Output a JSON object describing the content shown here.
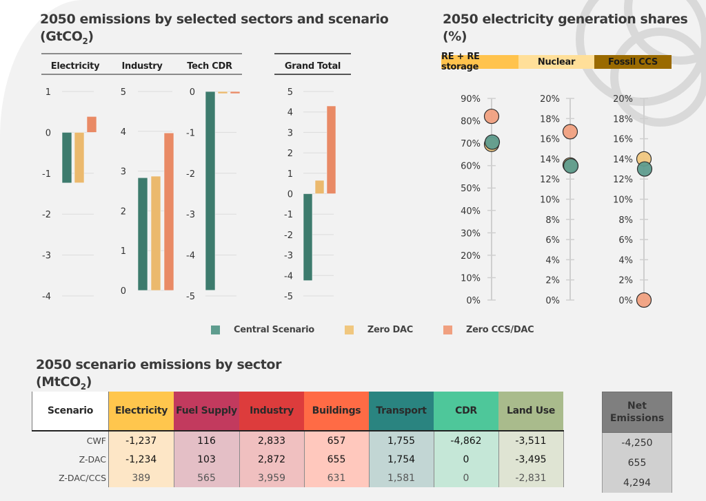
{
  "left_chart": {
    "title_line1": "2050 emissions by selected sectors and scenario",
    "title_line2_prefix": "(GtCO",
    "title_line2_sub": "2",
    "title_line2_suffix": ")",
    "panel_labels": [
      "Electricity",
      "Industry",
      "Tech CDR",
      "Grand Total"
    ]
  },
  "right_chart": {
    "title_line1": "2050 electricity generation shares",
    "title_line2": "(%)",
    "categories": [
      {
        "label": "RE + RE storage",
        "color": "#ffc34d"
      },
      {
        "label": "Nuclear",
        "color": "#ffdf99"
      },
      {
        "label": "Fossil CCS",
        "color": "#9a6a00"
      }
    ]
  },
  "legend": [
    {
      "label": "Central Scenario",
      "color": "#5e9c8e"
    },
    {
      "label": "Zero DAC",
      "color": "#f0c77f"
    },
    {
      "label": "Zero CCS/DAC",
      "color": "#f0a080"
    }
  ],
  "chart_data": [
    {
      "type": "bar",
      "title": "2050 emissions by selected sectors and scenario (GtCO2) - Electricity",
      "ylabel": "GtCO2",
      "categories": [
        "Electricity"
      ],
      "series": [
        {
          "name": "Central Scenario",
          "values": [
            -1.237
          ]
        },
        {
          "name": "Zero DAC",
          "values": [
            -1.234
          ]
        },
        {
          "name": "Zero CCS/DAC",
          "values": [
            0.389
          ]
        }
      ],
      "ylim": [
        -4,
        1
      ],
      "yticks": [
        1,
        0,
        -1,
        -2,
        -3,
        -4
      ],
      "grid": true
    },
    {
      "type": "bar",
      "title": "Industry",
      "ylabel": "GtCO2",
      "categories": [
        "Industry"
      ],
      "series": [
        {
          "name": "Central Scenario",
          "values": [
            2.833
          ]
        },
        {
          "name": "Zero DAC",
          "values": [
            2.872
          ]
        },
        {
          "name": "Zero CCS/DAC",
          "values": [
            3.959
          ]
        }
      ],
      "ylim": [
        0,
        5
      ],
      "yticks": [
        5,
        4,
        3,
        2,
        1,
        0
      ],
      "grid": true
    },
    {
      "type": "bar",
      "title": "Tech CDR",
      "ylabel": "GtCO2",
      "categories": [
        "Tech CDR"
      ],
      "series": [
        {
          "name": "Central Scenario",
          "values": [
            -4.862
          ]
        },
        {
          "name": "Zero DAC",
          "values": [
            -0.05
          ]
        },
        {
          "name": "Zero CCS/DAC",
          "values": [
            -0.05
          ]
        }
      ],
      "ylim": [
        -5,
        0
      ],
      "yticks": [
        0,
        -1,
        -2,
        -3,
        -4,
        -5
      ],
      "grid": true
    },
    {
      "type": "bar",
      "title": "Grand Total",
      "ylabel": "GtCO2",
      "categories": [
        "Grand Total"
      ],
      "series": [
        {
          "name": "Central Scenario",
          "values": [
            -4.25
          ]
        },
        {
          "name": "Zero DAC",
          "values": [
            0.655
          ]
        },
        {
          "name": "Zero CCS/DAC",
          "values": [
            4.294
          ]
        }
      ],
      "ylim": [
        -5,
        5
      ],
      "yticks": [
        5,
        4,
        3,
        2,
        1,
        0,
        -1,
        -2,
        -3,
        -4,
        -5
      ],
      "grid": true
    },
    {
      "type": "scatter",
      "title": "2050 electricity generation shares (%) - RE + RE storage",
      "ylabel": "%",
      "series": [
        {
          "name": "Central Scenario",
          "values": [
            70.5
          ]
        },
        {
          "name": "Zero DAC",
          "values": [
            69.5
          ]
        },
        {
          "name": "Zero CCS/DAC",
          "values": [
            82
          ]
        }
      ],
      "ylim": [
        0,
        90
      ],
      "yticks": [
        "0%",
        "10%",
        "20%",
        "30%",
        "40%",
        "50%",
        "60%",
        "70%",
        "80%",
        "90%"
      ]
    },
    {
      "type": "scatter",
      "title": "Nuclear",
      "ylabel": "%",
      "series": [
        {
          "name": "Central Scenario",
          "values": [
            13.3
          ]
        },
        {
          "name": "Zero DAC",
          "values": [
            13.4
          ]
        },
        {
          "name": "Zero CCS/DAC",
          "values": [
            16.7
          ]
        }
      ],
      "ylim": [
        0,
        20
      ],
      "yticks": [
        "0%",
        "2%",
        "4%",
        "6%",
        "8%",
        "10%",
        "12%",
        "14%",
        "16%",
        "18%",
        "20%"
      ]
    },
    {
      "type": "scatter",
      "title": "Fossil CCS",
      "ylabel": "%",
      "series": [
        {
          "name": "Central Scenario",
          "values": [
            13.0
          ]
        },
        {
          "name": "Zero DAC",
          "values": [
            14.0
          ]
        },
        {
          "name": "Zero CCS/DAC",
          "values": [
            0
          ]
        }
      ],
      "ylim": [
        0,
        20
      ],
      "yticks": [
        "0%",
        "2%",
        "4%",
        "6%",
        "8%",
        "10%",
        "12%",
        "14%",
        "16%",
        "18%",
        "20%"
      ]
    },
    {
      "type": "table",
      "title": "2050 scenario emissions by sector (MtCO2)",
      "columns": [
        "Scenario",
        "Electricity",
        "Fuel Supply",
        "Industry",
        "Buildings",
        "Transport",
        "CDR",
        "Land Use",
        "Net Emissions"
      ],
      "rows": [
        [
          "CWF",
          "-1,237",
          "116",
          "2,833",
          "657",
          "1,755",
          "-4,862",
          "-3,511",
          "-4,250"
        ],
        [
          "Z-DAC",
          "-1,234",
          "103",
          "2,872",
          "655",
          "1,754",
          "0",
          "-3,495",
          "655"
        ],
        [
          "Z-DAC/CCS",
          "389",
          "565",
          "3,959",
          "631",
          "1,581",
          "0",
          "-2,831",
          "4,294"
        ]
      ]
    }
  ],
  "table": {
    "title_line1": "2050 scenario emissions by sector",
    "title_line2_prefix": "(MtCO",
    "title_line2_sub": "2",
    "title_line2_suffix": ")",
    "scenario_header": "Scenario",
    "columns": [
      {
        "label": "Electricity",
        "head": "#ffc64d",
        "cell": "#fde6c6"
      },
      {
        "label": "Fuel Supply",
        "head": "#c23a5e",
        "cell": "#e4bfc6"
      },
      {
        "label": "Industry",
        "head": "#dd3c3c",
        "cell": "#f0c0c0"
      },
      {
        "label": "Buildings",
        "head": "#ff6b45",
        "cell": "#ffc8bd"
      },
      {
        "label": "Transport",
        "head": "#2a8480",
        "cell": "#c2d6d4"
      },
      {
        "label": "CDR",
        "head": "#4ec79a",
        "cell": "#c5e7d7"
      },
      {
        "label": "Land Use",
        "head": "#a9bb8c",
        "cell": "#dfe4d3"
      }
    ],
    "rows": [
      {
        "scenario": "CWF",
        "values": [
          "-1,237",
          "116",
          "2,833",
          "657",
          "1,755",
          "-4,862",
          "-3,511"
        ],
        "net": "-4,250"
      },
      {
        "scenario": "Z-DAC",
        "values": [
          "-1,234",
          "103",
          "2,872",
          "655",
          "1,754",
          "0",
          "-3,495"
        ],
        "net": "655"
      },
      {
        "scenario": "Z-DAC/CCS",
        "values": [
          "389",
          "565",
          "3,959",
          "631",
          "1,581",
          "0",
          "-2,831"
        ],
        "net": "4,294"
      }
    ],
    "net_header_line1": "Net",
    "net_header_line2": "Emissions"
  }
}
